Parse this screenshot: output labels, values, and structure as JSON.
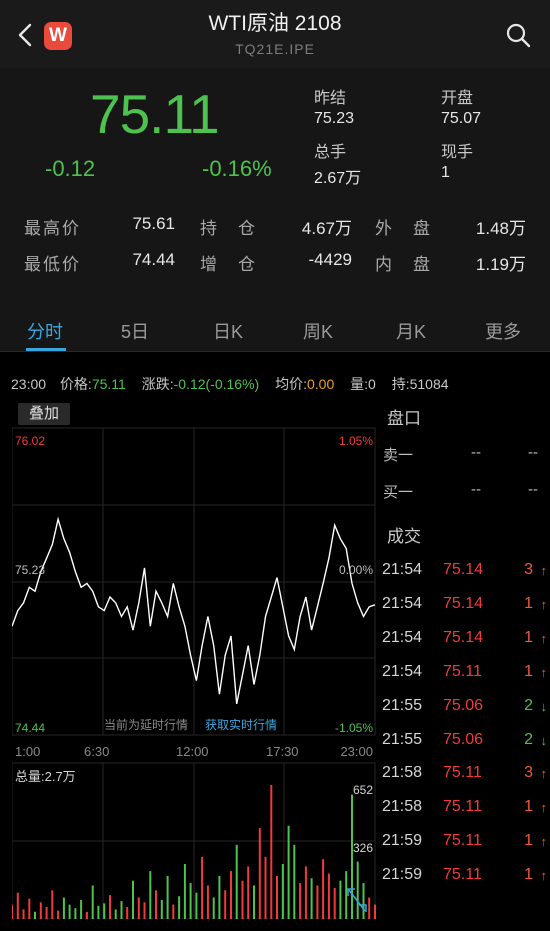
{
  "header": {
    "back_label": "back",
    "app_logo": "W",
    "title": "WTI原油 2108",
    "code": "TQ21E.IPE"
  },
  "quote": {
    "price": "75.11",
    "change": "-0.12",
    "change_pct": "-0.16%",
    "prev_settle_label": "昨结",
    "prev_settle": "75.23",
    "open_label": "开盘",
    "open": "75.07",
    "total_vol_label": "总手",
    "total_vol": "2.67万",
    "cur_vol_label": "现手",
    "cur_vol": "1",
    "high_label": "最高价",
    "high": "75.61",
    "low_label": "最低价",
    "low": "74.44",
    "oi_label": "持　仓",
    "oi": "4.67万",
    "oi_chg_label": "增　仓",
    "oi_chg": "-4429",
    "outer_label": "外　盘",
    "outer": "1.48万",
    "inner_label": "内　盘",
    "inner": "1.19万"
  },
  "tabs": [
    "分时",
    "5日",
    "日K",
    "周K",
    "月K",
    "更多"
  ],
  "infobar": {
    "time": "23:00",
    "price_label": "价格:",
    "price": "75.11",
    "chg_label": "涨跌:",
    "chg": "-0.12(-0.16%)",
    "avg_label": "均价:",
    "avg": "0.00",
    "vol_label": "量:",
    "vol": "0",
    "oi_label": "持:",
    "oi": "51084"
  },
  "chart": {
    "overlay_label": "叠加",
    "y_max": "76.02",
    "y_mid": "75.23",
    "y_min": "74.44",
    "pct_max": "1.05%",
    "pct_mid": "0.00%",
    "pct_min": "-1.05%",
    "delay_notice": "当前为延时行情",
    "realtime_link": "获取实时行情",
    "x_labels": [
      "1:00",
      "6:30",
      "12:00",
      "17:30",
      "23:00"
    ],
    "vol_total": "总量:2.7万",
    "vol_max": "652",
    "vol_mid": "326",
    "colors": {
      "line": "#ffffff",
      "up": "#ef3b3b",
      "down": "#4ec24e",
      "grid": "#262626"
    }
  },
  "chart_data": {
    "type": "line",
    "x": [
      "1:00",
      "6:30",
      "12:00",
      "17:30",
      "23:00"
    ],
    "ylim": [
      74.44,
      76.02
    ],
    "series": [
      {
        "values": [
          75.0,
          75.08,
          75.12,
          75.2,
          75.18,
          75.28,
          75.35,
          75.42,
          75.55,
          75.45,
          75.38,
          75.28,
          75.2,
          75.22,
          75.18,
          75.1,
          75.08,
          75.15,
          75.12,
          75.05,
          75.1,
          74.98,
          75.12,
          75.3,
          75.0,
          75.18,
          75.12,
          75.05,
          75.22,
          75.1,
          75.0,
          74.85,
          74.72,
          74.9,
          75.05,
          74.9,
          74.65,
          74.85,
          74.95,
          74.6,
          74.75,
          74.9,
          74.7,
          74.85,
          75.05,
          75.15,
          75.25,
          75.1,
          74.95,
          74.88,
          75.05,
          75.15,
          74.98,
          75.1,
          75.22,
          75.35,
          75.52,
          75.45,
          75.4,
          75.22,
          75.12,
          75.05,
          75.1,
          75.11
        ]
      }
    ],
    "volume": [
      60,
      110,
      40,
      85,
      30,
      70,
      50,
      120,
      35,
      90,
      60,
      45,
      80,
      30,
      140,
      55,
      65,
      100,
      40,
      75,
      50,
      160,
      90,
      70,
      200,
      120,
      80,
      180,
      60,
      95,
      230,
      150,
      110,
      260,
      140,
      90,
      180,
      120,
      200,
      310,
      160,
      220,
      140,
      380,
      260,
      560,
      180,
      230,
      390,
      310,
      150,
      220,
      170,
      140,
      250,
      190,
      130,
      160,
      200,
      520,
      240,
      150,
      90,
      60
    ]
  },
  "orderbook": {
    "title": "盘口",
    "sell1_label": "卖一",
    "sell1_price": "--",
    "sell1_vol": "--",
    "buy1_label": "买一",
    "buy1_price": "--",
    "buy1_vol": "--"
  },
  "trades": {
    "title": "成交",
    "rows": [
      {
        "time": "21:54",
        "price": "75.14",
        "vol": "3",
        "dir": "up"
      },
      {
        "time": "21:54",
        "price": "75.14",
        "vol": "1",
        "dir": "up"
      },
      {
        "time": "21:54",
        "price": "75.14",
        "vol": "1",
        "dir": "up"
      },
      {
        "time": "21:54",
        "price": "75.11",
        "vol": "1",
        "dir": "up"
      },
      {
        "time": "21:55",
        "price": "75.06",
        "vol": "2",
        "dir": "down"
      },
      {
        "time": "21:55",
        "price": "75.06",
        "vol": "2",
        "dir": "down"
      },
      {
        "time": "21:58",
        "price": "75.11",
        "vol": "3",
        "dir": "up"
      },
      {
        "time": "21:58",
        "price": "75.11",
        "vol": "1",
        "dir": "up"
      },
      {
        "time": "21:59",
        "price": "75.11",
        "vol": "1",
        "dir": "up"
      },
      {
        "time": "21:59",
        "price": "75.11",
        "vol": "1",
        "dir": "up"
      }
    ]
  }
}
